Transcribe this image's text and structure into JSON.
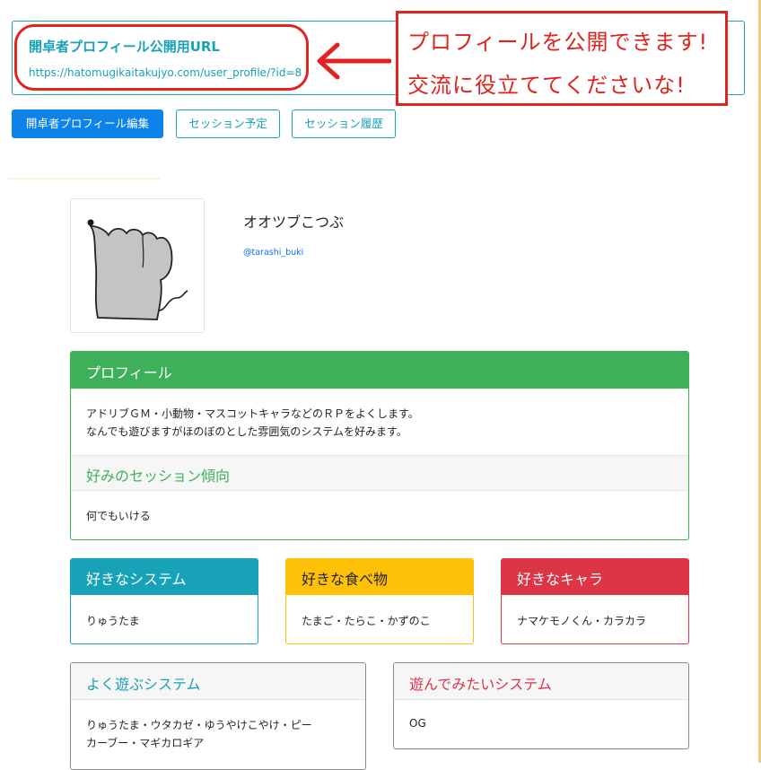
{
  "public_url": {
    "title": "開卓者プロフィール公開用URL",
    "link": "https://hatomugikaitakujyo.com/user_profile/?id=8"
  },
  "annotation": {
    "line1": "プロフィールを公開できます!",
    "line2": "交流に役立ててくださいな!",
    "color": "#e0231f"
  },
  "buttons": {
    "edit_profile": "開卓者プロフィール編集",
    "session_schedule": "セッション予定",
    "session_history": "セッション履歴"
  },
  "user": {
    "name": "オオツブこつぶ",
    "handle": "@tarashi_buki"
  },
  "profile": {
    "heading": "プロフィール",
    "text_line1": "アドリブＧＭ・小動物・マスコットキャラなどのＲＰをよくします。",
    "text_line2": "なんでも遊びますがほのぼのとした雰囲気のシステムを好みます。",
    "preference_heading": "好みのセッション傾向",
    "preference_value": "何でもいける"
  },
  "favorites": {
    "system_heading": "好きなシステム",
    "system_value": "りゅうたま",
    "food_heading": "好きな食べ物",
    "food_value": "たまご・たらこ・かずのこ",
    "character_heading": "好きなキャラ",
    "character_value": "ナマケモノくん・カラカラ"
  },
  "systems": {
    "often_heading": "よく遊ぶシステム",
    "often_line1": "りゅうたま・ウタカゼ・ゆうやけこやけ・ピー",
    "often_line2": "カーブー・マギカロギア",
    "want_heading": "遊んでみたいシステム",
    "want_value": "OG"
  },
  "colors": {
    "primary": "#0d82ea",
    "info": "#17a2b8",
    "success": "#3eb05a",
    "warning": "#ffc107",
    "danger": "#dc3545"
  },
  "icons": {
    "avatar": "hand-drawn-animal-avatar",
    "arrow": "left-arrow-icon"
  }
}
